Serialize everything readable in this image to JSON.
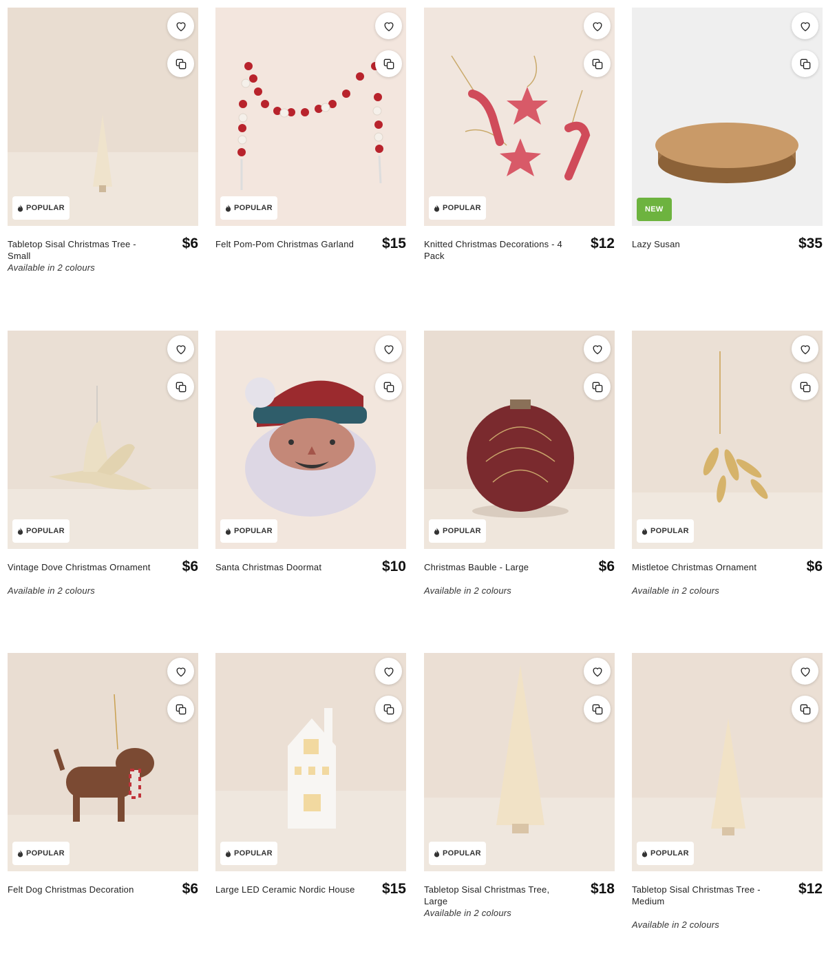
{
  "badges": {
    "popular": "POPULAR",
    "new": "NEW"
  },
  "colors": {
    "new_badge": "#6db33f",
    "photo_bg": "#ede3d8"
  },
  "products": [
    {
      "name": "Tabletop Sisal Christmas Tree - Small",
      "price": "$6",
      "badge": "POPULAR",
      "colours_note": "Available in 2 colours"
    },
    {
      "name": "Felt Pom-Pom Christmas Garland",
      "price": "$15",
      "badge": "POPULAR",
      "colours_note": ""
    },
    {
      "name": "Knitted Christmas Decorations - 4 Pack",
      "price": "$12",
      "badge": "POPULAR",
      "colours_note": ""
    },
    {
      "name": "Lazy Susan",
      "price": "$35",
      "badge": "NEW",
      "colours_note": ""
    },
    {
      "name": "Vintage Dove Christmas Ornament",
      "price": "$6",
      "badge": "POPULAR",
      "colours_note": "Available in 2 colours"
    },
    {
      "name": "Santa Christmas Doormat",
      "price": "$10",
      "badge": "POPULAR",
      "colours_note": ""
    },
    {
      "name": "Christmas Bauble - Large",
      "price": "$6",
      "badge": "POPULAR",
      "colours_note": "Available in 2 colours"
    },
    {
      "name": "Mistletoe Christmas Ornament",
      "price": "$6",
      "badge": "POPULAR",
      "colours_note": "Available in 2 colours"
    },
    {
      "name": "Felt Dog Christmas Decoration",
      "price": "$6",
      "badge": "POPULAR",
      "colours_note": ""
    },
    {
      "name": "Large LED Ceramic Nordic House",
      "price": "$15",
      "badge": "POPULAR",
      "colours_note": ""
    },
    {
      "name": "Tabletop Sisal Christmas Tree, Large",
      "price": "$18",
      "badge": "POPULAR",
      "colours_note": "Available in 2 colours"
    },
    {
      "name": "Tabletop Sisal Christmas Tree - Medium",
      "price": "$12",
      "badge": "POPULAR",
      "colours_note": "Available in 2 colours"
    }
  ]
}
